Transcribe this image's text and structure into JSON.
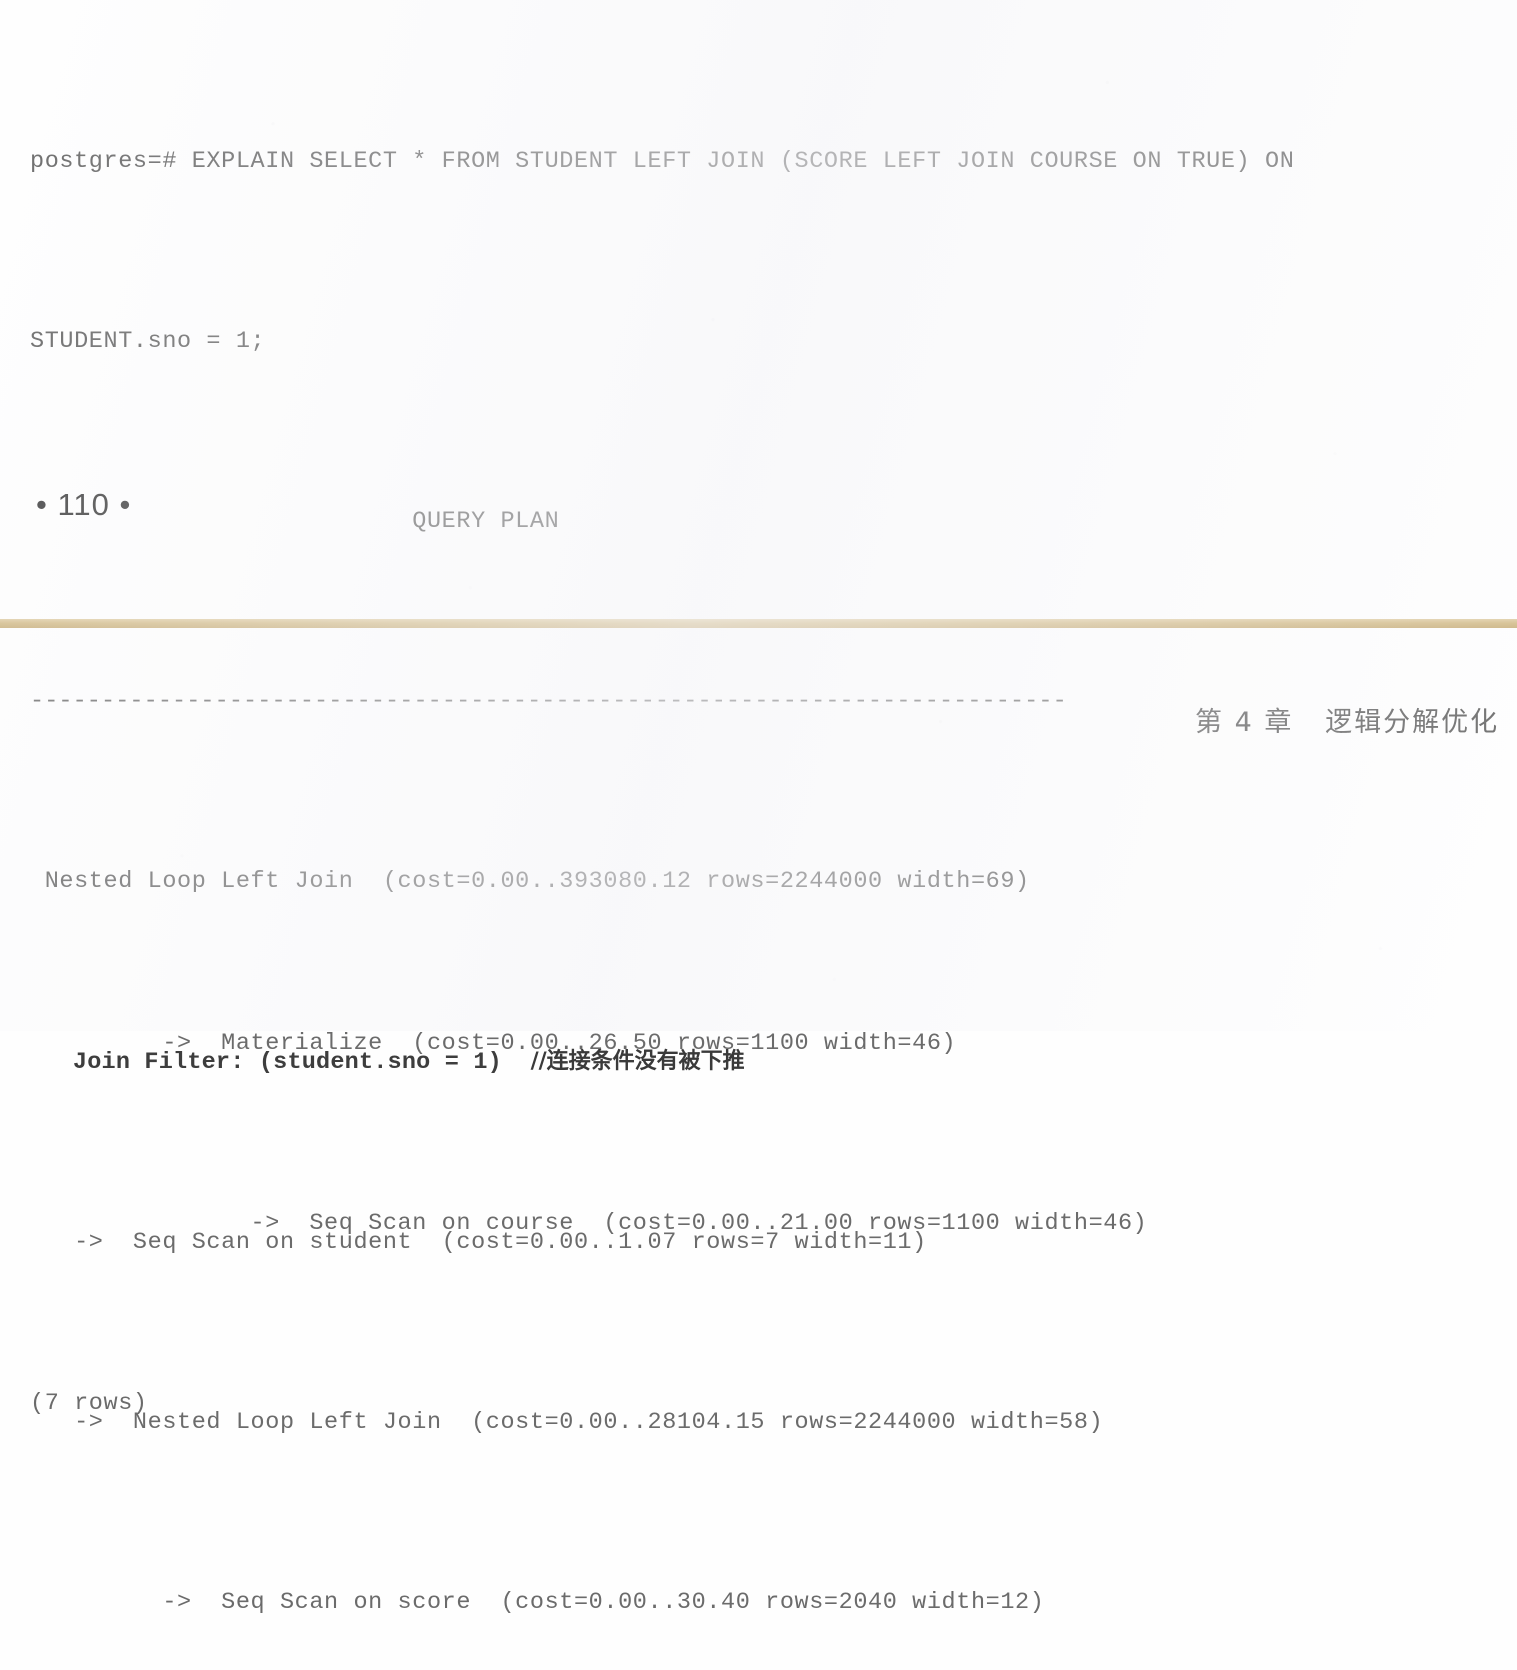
{
  "page": {
    "page_number_marker": "• 110 •",
    "background_color": "#fefefe",
    "rule_color": "#d6c193"
  },
  "running_head": {
    "text": "第 4 章   逻辑分解优化"
  },
  "terminal_top": {
    "prompt_line_1": "postgres=# EXPLAIN SELECT * FROM STUDENT LEFT JOIN (SCORE LEFT JOIN COURSE ON TRUE) ON",
    "prompt_line_2": "STUDENT.sno = 1;",
    "plan_header": "                          QUERY PLAN",
    "separator": "-------------------------------------------------------------------------",
    "plan_lines": [
      {
        "text": " Nested Loop Left Join  (cost=0.00..393080.12 rows=2244000 width=69)",
        "bold": false,
        "comment": ""
      },
      {
        "text": "   Join Filter: (student.sno = 1)  ",
        "bold": true,
        "comment": "//连接条件没有被下推"
      },
      {
        "text": "   ->  Seq Scan on student  (cost=0.00..1.07 rows=7 width=11)",
        "bold": false,
        "comment": ""
      },
      {
        "text": "   ->  Nested Loop Left Join  (cost=0.00..28104.15 rows=2244000 width=58)",
        "bold": false,
        "comment": ""
      },
      {
        "text": "         ->  Seq Scan on score  (cost=0.00..30.40 rows=2040 width=12)",
        "bold": false,
        "comment": ""
      }
    ]
  },
  "terminal_bottom": {
    "plan_lines": [
      {
        "text": "         ->  Materialize  (cost=0.00..26.50 rows=1100 width=46)",
        "bold": false,
        "comment": ""
      },
      {
        "text": "               ->  Seq Scan on course  (cost=0.00..21.00 rows=1100 width=46)",
        "bold": false,
        "comment": ""
      }
    ],
    "row_count": "(7 rows)"
  }
}
